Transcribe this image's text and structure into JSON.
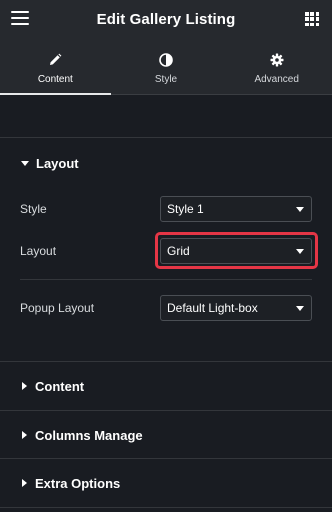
{
  "header": {
    "title": "Edit Gallery Listing",
    "menu_icon": "hamburger-menu-icon",
    "apps_icon": "grid-apps-icon"
  },
  "tabs": [
    {
      "label": "Content",
      "icon": "pencil-icon",
      "active": true
    },
    {
      "label": "Style",
      "icon": "half-circle-icon",
      "active": false
    },
    {
      "label": "Advanced",
      "icon": "gear-icon",
      "active": false
    }
  ],
  "sections": {
    "layout": {
      "title": "Layout",
      "expanded": true,
      "controls": {
        "style": {
          "label": "Style",
          "value": "Style 1"
        },
        "layout": {
          "label": "Layout",
          "value": "Grid"
        },
        "popup_layout": {
          "label": "Popup Layout",
          "value": "Default Light-box"
        }
      }
    },
    "content": {
      "title": "Content",
      "expanded": false
    },
    "columns_manage": {
      "title": "Columns Manage",
      "expanded": false
    },
    "extra_options": {
      "title": "Extra Options",
      "expanded": false
    }
  },
  "colors": {
    "background": "#191c22",
    "panel": "#26292e",
    "highlight": "#e53646"
  }
}
